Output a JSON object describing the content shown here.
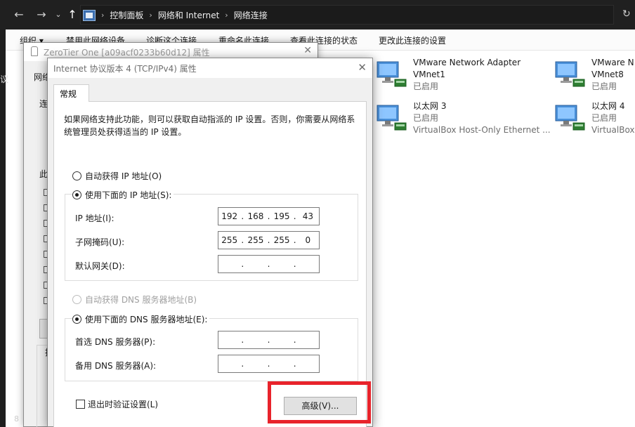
{
  "explorer": {
    "crumbs": [
      "控制面板",
      "网络和 Internet",
      "网络连接"
    ],
    "commands": [
      "组织 ▾",
      "禁用此网络设备",
      "诊断这个连接",
      "重命名此连接",
      "查看此连接的状态",
      "更改此连接的设置"
    ],
    "adapters": [
      {
        "name": "VMware Network Adapter",
        "sub1": "VMnet1",
        "sub2": "已启用"
      },
      {
        "name": "VMware N",
        "sub1": "VMnet8",
        "sub2": "已启用"
      },
      {
        "name": "以太网 3",
        "sub1": "已启用",
        "sub2": "VirtualBox Host-Only Ethernet ..."
      },
      {
        "name": "以太网 4",
        "sub1": "已启用",
        "sub2": "VirtualBox"
      }
    ],
    "left_fragment": "议",
    "bottom_fragment": "8"
  },
  "zerotier": {
    "title": "ZeroTier One [a09acf0233b60d12] 属性",
    "frag_tab": "网络",
    "frag_connect": "连",
    "frag_this": "此",
    "frag_bottom": "抗"
  },
  "ipv4": {
    "title": "Internet 协议版本 4 (TCP/IPv4) 属性",
    "tab": "常规",
    "description": "如果网络支持此功能，则可以获取自动指派的 IP 设置。否则，你需要从网络系统管理员处获得适当的 IP 设置。",
    "auto_ip": "自动获得 IP 地址(O)",
    "manual_ip": "使用下面的 IP 地址(S):",
    "ip_label": "IP 地址(I):",
    "ip_value": [
      "192",
      "168",
      "195",
      "43"
    ],
    "mask_label": "子网掩码(U):",
    "mask_value": [
      "255",
      "255",
      "255",
      "0"
    ],
    "gateway_label": "默认网关(D):",
    "gateway_value": [
      "",
      "",
      "",
      ""
    ],
    "auto_dns": "自动获得 DNS 服务器地址(B)",
    "manual_dns": "使用下面的 DNS 服务器地址(E):",
    "dns1_label": "首选 DNS 服务器(P):",
    "dns1_value": [
      "",
      "",
      "",
      ""
    ],
    "dns2_label": "备用 DNS 服务器(A):",
    "dns2_value": [
      "",
      "",
      "",
      ""
    ],
    "validate": "退出时验证设置(L)",
    "advanced": "高级(V)..."
  },
  "colors": {
    "highlight": "#e8232b"
  }
}
